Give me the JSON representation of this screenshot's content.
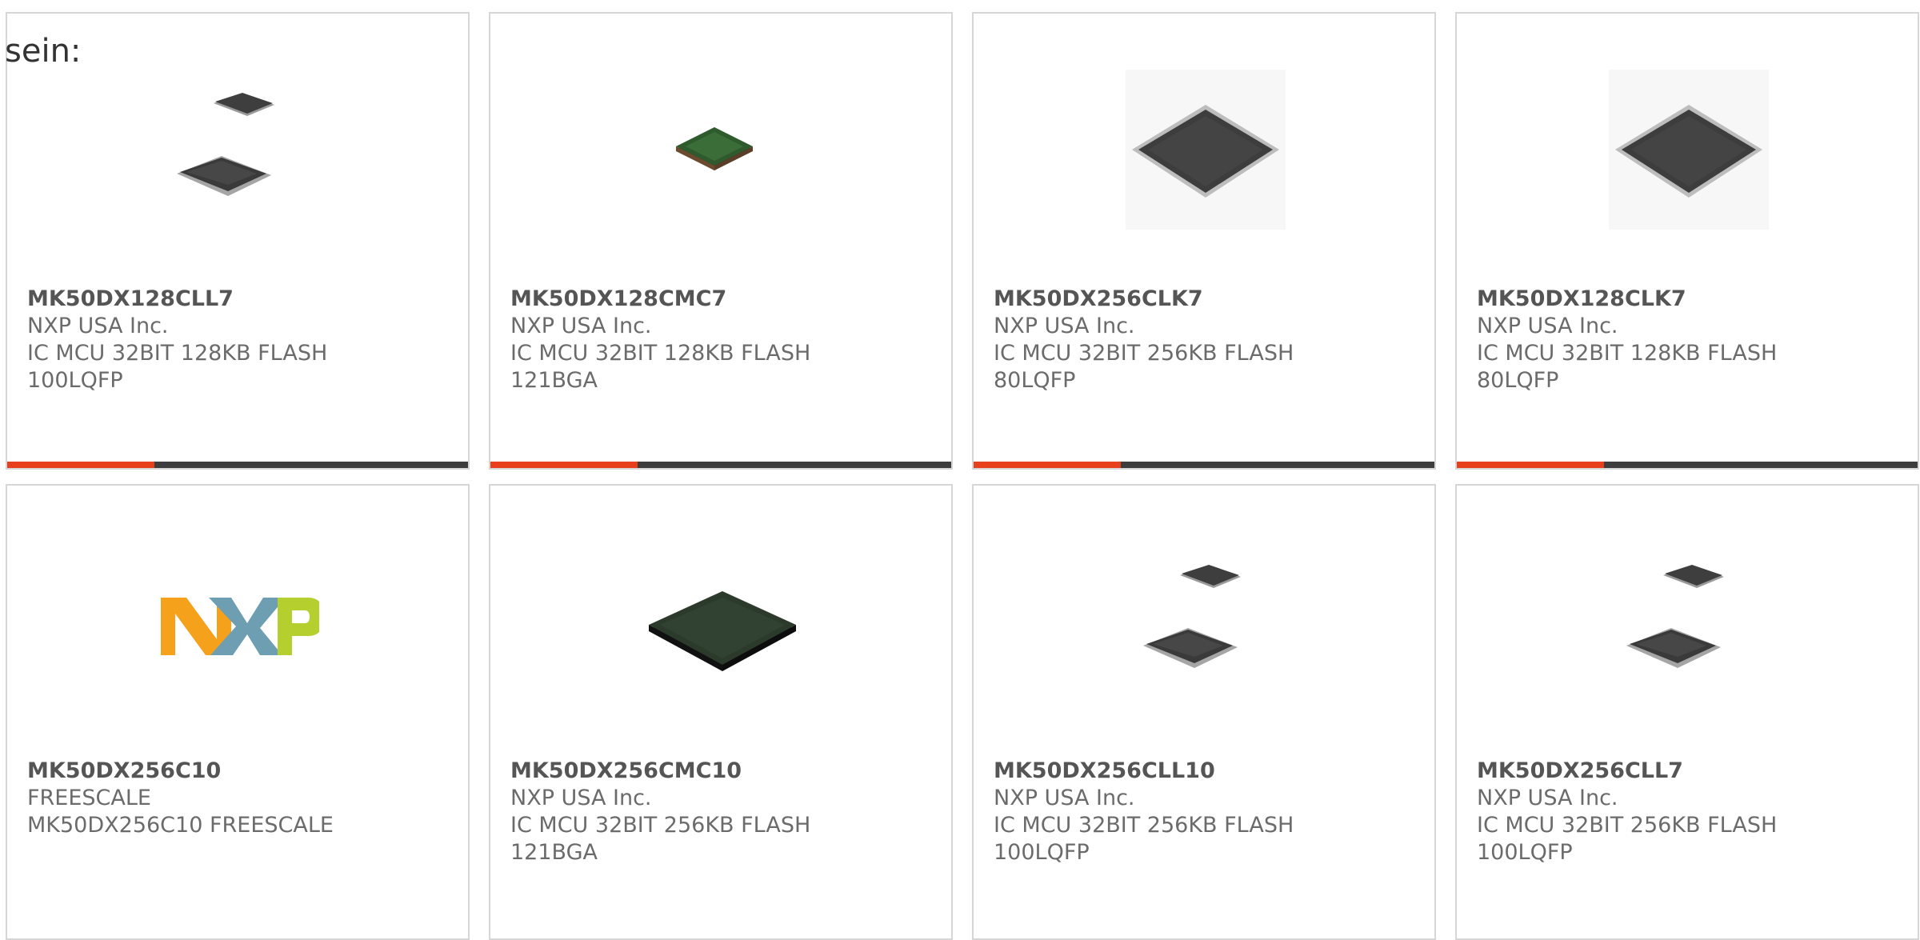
{
  "intro_text": "sein:",
  "colors": {
    "accent": "#e8401c",
    "bar_track": "#3d3d3d",
    "card_border": "#d6d6d6"
  },
  "products": [
    {
      "part": "MK50DX128CLL7",
      "manufacturer": "NXP USA Inc.",
      "desc1": "IC MCU 32BIT 128KB FLASH",
      "desc2": "100LQFP",
      "image": "dual-lqfp-chip",
      "progress": 0.32
    },
    {
      "part": "MK50DX128CMC7",
      "manufacturer": "NXP USA Inc.",
      "desc1": "IC MCU 32BIT 128KB FLASH",
      "desc2": "121BGA",
      "image": "small-bga-chip",
      "progress": 0.32
    },
    {
      "part": "MK50DX256CLK7",
      "manufacturer": "NXP USA Inc.",
      "desc1": "IC MCU 32BIT 256KB FLASH",
      "desc2": "80LQFP",
      "image": "qfp-chip",
      "progress": 0.32
    },
    {
      "part": "MK50DX128CLK7",
      "manufacturer": "NXP USA Inc.",
      "desc1": "IC MCU 32BIT 128KB FLASH",
      "desc2": "80LQFP",
      "image": "qfp-chip",
      "progress": 0.32
    },
    {
      "part": "MK50DX256C10",
      "manufacturer": "FREESCALE",
      "desc1": "MK50DX256C10 FREESCALE",
      "desc2": "",
      "image": "nxp-logo",
      "progress": null
    },
    {
      "part": "MK50DX256CMC10",
      "manufacturer": "NXP USA Inc.",
      "desc1": "IC MCU 32BIT 256KB FLASH",
      "desc2": "121BGA",
      "image": "large-bga-chip",
      "progress": null
    },
    {
      "part": "MK50DX256CLL10",
      "manufacturer": "NXP USA Inc.",
      "desc1": "IC MCU 32BIT 256KB FLASH",
      "desc2": "100LQFP",
      "image": "dual-lqfp-chip",
      "progress": null
    },
    {
      "part": "MK50DX256CLL7",
      "manufacturer": "NXP USA Inc.",
      "desc1": "IC MCU 32BIT 256KB FLASH",
      "desc2": "100LQFP",
      "image": "dual-lqfp-chip",
      "progress": null
    }
  ]
}
